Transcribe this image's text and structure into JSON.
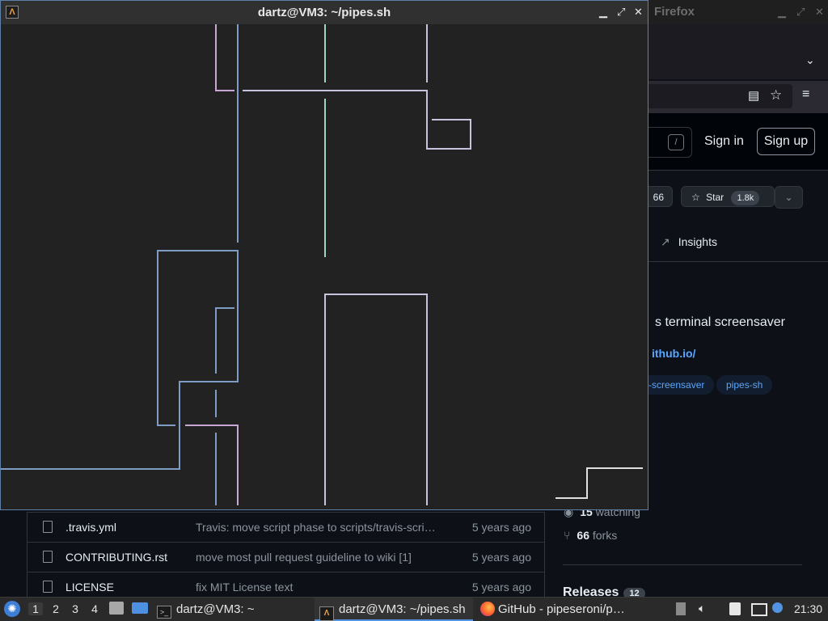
{
  "firefox": {
    "title": "Firefox",
    "github": {
      "slash_hint": "/",
      "sign_in": "Sign in",
      "sign_up": "Sign up",
      "fork_count_partial": "66",
      "star_label": "Star",
      "star_count": "1.8k",
      "insights_tab": "Insights",
      "about_partial": "s terminal screensaver",
      "website_partial": "ithub.io/",
      "topics": [
        "-screensaver",
        "pipes-sh"
      ],
      "watching_count": "15",
      "watching_label": "watching",
      "forks_count": "66",
      "forks_label": "forks",
      "releases_label": "Releases",
      "releases_count": "12",
      "files": [
        {
          "name": ".travis.yml",
          "message": "Travis: move script phase to scripts/travis-scri…",
          "date": "5 years ago"
        },
        {
          "name": "CONTRIBUTING.rst",
          "message": "move most pull request guideline to wiki [1]",
          "date": "5 years ago"
        },
        {
          "name": "LICENSE",
          "message": "fix MIT License text",
          "date": "5 years ago"
        }
      ]
    }
  },
  "terminal": {
    "title": "dartz@VM3: ~/pipes.sh",
    "app_icon": "pipes-app-icon",
    "pipe_colors": {
      "blue": "#7f9cc4",
      "pink": "#c9a7d4",
      "mint": "#9fd4c4",
      "lavender": "#c8c3dc",
      "white": "#e0e0e0"
    }
  },
  "taskbar": {
    "workspaces": [
      "1",
      "2",
      "3",
      "4"
    ],
    "active_workspace": "1",
    "tasks": [
      {
        "label": "dartz@VM3: ~"
      },
      {
        "label": "dartz@VM3: ~/pipes.sh"
      },
      {
        "label": "GitHub - pipeseroni/p…"
      }
    ],
    "clock": "21:30"
  }
}
